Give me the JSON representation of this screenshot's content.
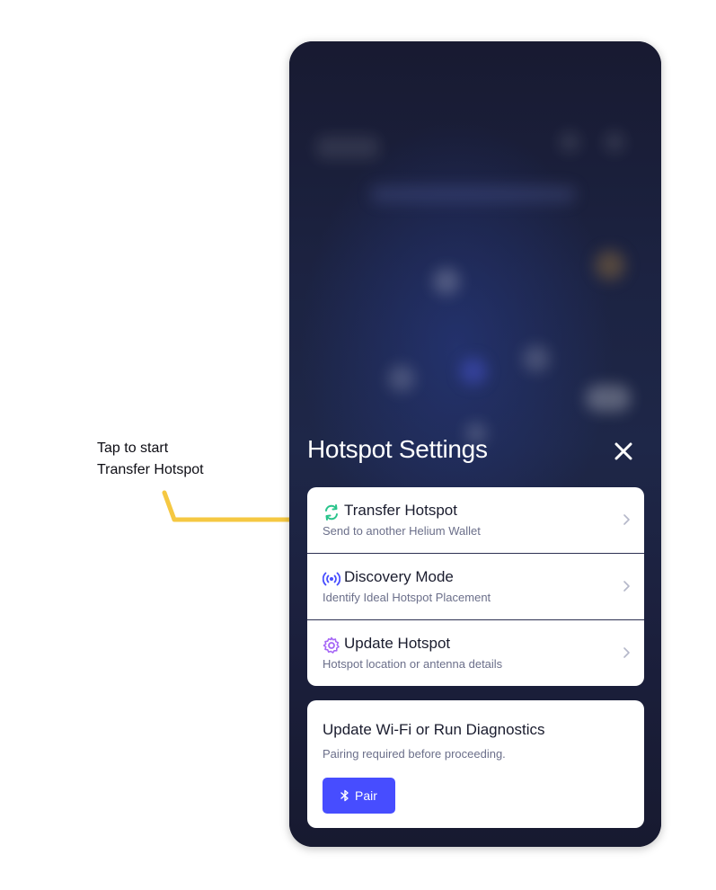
{
  "annotation": {
    "line1": "Tap to start",
    "line2": "Transfer Hotspot",
    "color": "#f5c842"
  },
  "sheet": {
    "title": "Hotspot Settings",
    "close_icon": "close-icon"
  },
  "menu": {
    "items": [
      {
        "label": "Transfer Hotspot",
        "subtitle": "Send to another Helium Wallet",
        "icon": "transfer-icon",
        "icon_color": "#29c48b"
      },
      {
        "label": "Discovery Mode",
        "subtitle": "Identify Ideal Hotspot Placement",
        "icon": "broadcast-icon",
        "icon_color": "#474dff"
      },
      {
        "label": "Update Hotspot",
        "subtitle": "Hotspot location or antenna details",
        "icon": "gear-icon",
        "icon_color": "#a667f6"
      }
    ]
  },
  "diagnostics": {
    "title": "Update Wi-Fi or Run Diagnostics",
    "subtitle": "Pairing required before proceeding.",
    "pair_label": "Pair",
    "pair_icon": "bluetooth-icon",
    "button_color": "#474dff"
  }
}
